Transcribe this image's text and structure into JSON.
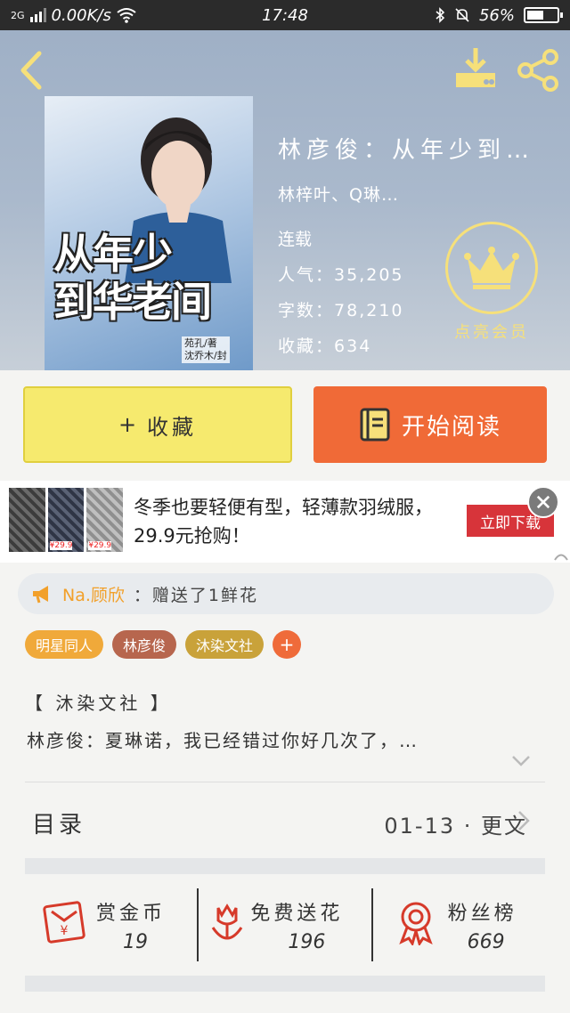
{
  "status_bar": {
    "network": "2G",
    "speed": "0.00K/s",
    "time": "17:48",
    "battery": "56%",
    "battery_level": 0.56
  },
  "header": {
    "back_icon": "chevron-left-icon",
    "download_icon": "download-icon",
    "share_icon": "share-icon"
  },
  "cover": {
    "title_line1": "从年少",
    "title_line2": "到华老间",
    "credit_line1": "苑孔/著",
    "credit_line2": "沈乔木/封"
  },
  "book": {
    "title": "林彦俊：从年少到…",
    "author": "林梓叶、Q琳…",
    "status": "连载",
    "stats": [
      {
        "label": "人气",
        "value": "35,205"
      },
      {
        "label": "字数",
        "value": "78,210"
      },
      {
        "label": "收藏",
        "value": "634"
      }
    ]
  },
  "member": {
    "label": "点亮会员",
    "icon": "crown-icon"
  },
  "actions": {
    "favorite_label": "收藏",
    "favorite_plus": "+",
    "read_label": "开始阅读",
    "read_icon": "book-icon"
  },
  "ad": {
    "text": "冬季也要轻便有型，轻薄款羽绒服，29.9元抢购！",
    "cta": "立即下载",
    "thumb_prices": [
      "¥29.9",
      "¥29.9"
    ],
    "close_icon": "close-icon"
  },
  "gift": {
    "icon": "megaphone-icon",
    "user": "Na.顾欣",
    "text": "：赠送了1鲜花"
  },
  "tags": [
    {
      "label": "明星同人",
      "color": "#f0a93a"
    },
    {
      "label": "林彦俊",
      "color": "#b7664e"
    },
    {
      "label": "沐染文社",
      "color": "#c9a23a"
    }
  ],
  "tag_add": "+",
  "summary": {
    "source": "【 沐染文社 】",
    "text": "林彦俊：夏琳诺，我已经错过你好几次了，…"
  },
  "catalog": {
    "label": "目录",
    "update": "01-13 · 更文"
  },
  "stats_row": [
    {
      "label": "赏金币",
      "value": "19",
      "icon": "red-envelope-icon"
    },
    {
      "label": "免费送花",
      "value": "196",
      "icon": "flower-icon"
    },
    {
      "label": "粉丝榜",
      "value": "669",
      "icon": "medal-icon"
    }
  ],
  "colors": {
    "accent_orange": "#f06a37",
    "favorite_yellow": "#f6ea6e",
    "icon_red": "#d63a2a",
    "crown_yellow": "#f6e07a"
  }
}
